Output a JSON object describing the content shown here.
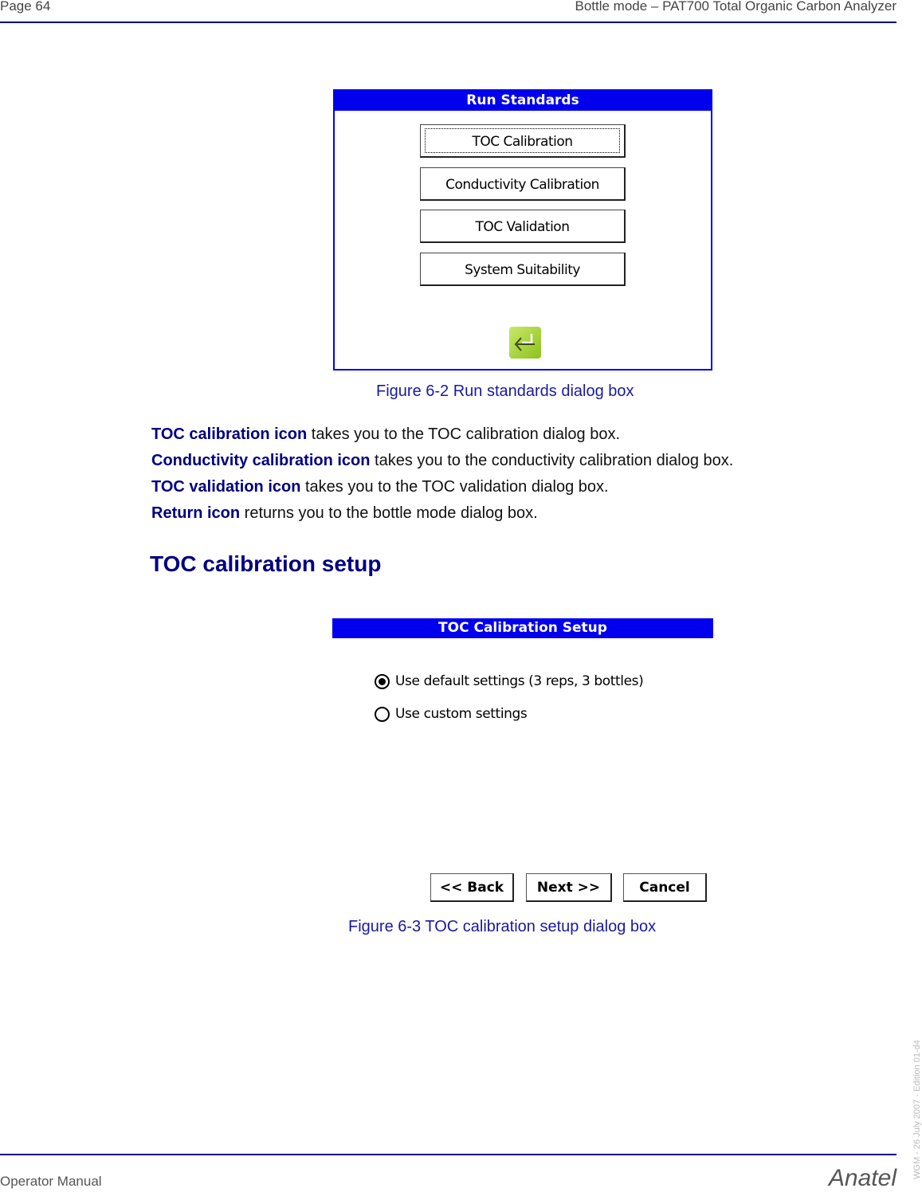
{
  "header": {
    "page": "Page 64",
    "title": "Bottle mode – PAT700 Total Organic Carbon Analyzer"
  },
  "footer": {
    "left": "Operator Manual",
    "brand": "Anatel",
    "side_note": "WGM - 26 July 2007 - Edition 01-d4"
  },
  "figure1": {
    "dialog_title": "Run Standards",
    "buttons": [
      "TOC Calibration",
      "Conductivity Calibration",
      "TOC Validation",
      "System Suitability"
    ],
    "return_icon": "return-arrow-icon",
    "caption": "Figure 6-2 Run standards dialog box"
  },
  "descriptions": [
    {
      "term": "TOC calibration icon",
      "text": " takes you to the TOC calibration dialog box."
    },
    {
      "term": "Conductivity calibration icon",
      "text": " takes you to the conductivity calibration dialog box."
    },
    {
      "term": "TOC validation icon",
      "text": " takes you to the TOC validation dialog box."
    },
    {
      "term": "Return icon",
      "text": " returns you to the bottle mode dialog box."
    }
  ],
  "section_heading": "TOC calibration setup",
  "figure2": {
    "dialog_title": "TOC Calibration Setup",
    "options": [
      {
        "label": "Use default settings (3 reps, 3 bottles)",
        "selected": true
      },
      {
        "label": "Use custom settings",
        "selected": false
      }
    ],
    "back_label": "<< Back",
    "next_label": "Next >>",
    "cancel_label": "Cancel",
    "caption": "Figure 6-3 TOC calibration setup dialog box"
  }
}
